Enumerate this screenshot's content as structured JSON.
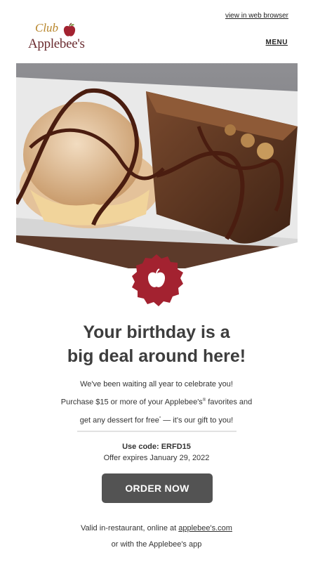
{
  "header": {
    "view_in_browser": "view in web browser",
    "logo_club": "Club",
    "logo_brand": "Applebee's",
    "menu": "MENU"
  },
  "hero": {
    "icon": "apple-icon"
  },
  "headline": {
    "line1": "Your birthday is a",
    "line2": "big deal around here!"
  },
  "body": {
    "line1": "We've been waiting all year to celebrate you!",
    "line2_pre": "Purchase $15 or more of your Applebee's",
    "line2_reg": "®",
    "line2_post": " favorites and",
    "line3_pre": "get any dessert for free",
    "line3_star": "*",
    "line3_post": " — it's our gift to you!"
  },
  "offer": {
    "code": "Use code: ERFD15",
    "expires": "Offer expires January 29, 2022"
  },
  "cta": {
    "label": "ORDER NOW"
  },
  "footer": {
    "valid_pre": "Valid in-restaurant, online at ",
    "valid_link": "applebee's.com",
    "app": "or with the Applebee's app"
  },
  "colors": {
    "brand_red": "#a32230",
    "cta_bg": "#535353",
    "headline": "#3d3d3d"
  }
}
